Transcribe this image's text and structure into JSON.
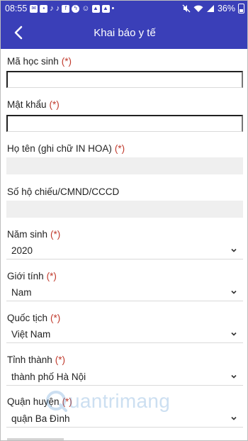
{
  "status_bar": {
    "time": "08:55",
    "battery": "36%",
    "icons": [
      "sms-icon",
      "hd-icon",
      "tiktok-icon",
      "tiktok-icon",
      "facebook-icon",
      "messenger-icon",
      "viber-icon",
      "image-icon",
      "photos-icon",
      "dot-icon",
      "mute-icon",
      "wifi-icon",
      "signal-icon",
      "battery-icon"
    ]
  },
  "app_bar": {
    "title": "Khai báo y tế",
    "back_icon": "chevron-left-icon"
  },
  "form": {
    "required_mark": "(*)",
    "student_id": {
      "label": "Mã học sinh",
      "value": ""
    },
    "password": {
      "label": "Mật khẩu",
      "value": ""
    },
    "full_name": {
      "label": "Họ tên (ghi chữ IN HOA)",
      "value": ""
    },
    "id_number": {
      "label": "Số hộ chiếu/CMND/CCCD",
      "value": ""
    },
    "birth_year": {
      "label": "Năm sinh",
      "value": "2020"
    },
    "gender": {
      "label": "Giới tính",
      "value": "Nam"
    },
    "nationality": {
      "label": "Quốc tịch",
      "value": "Việt Nam"
    },
    "province": {
      "label": "Tỉnh thành",
      "value": "thành phố Hà Nội"
    },
    "district": {
      "label": "Quận huyện",
      "value": "quận Ba Đình"
    }
  },
  "watermark": {
    "text": "uantrimang"
  },
  "colors": {
    "primary": "#3a3fb8",
    "required": "#c0392b",
    "filled_input": "#efefef"
  }
}
